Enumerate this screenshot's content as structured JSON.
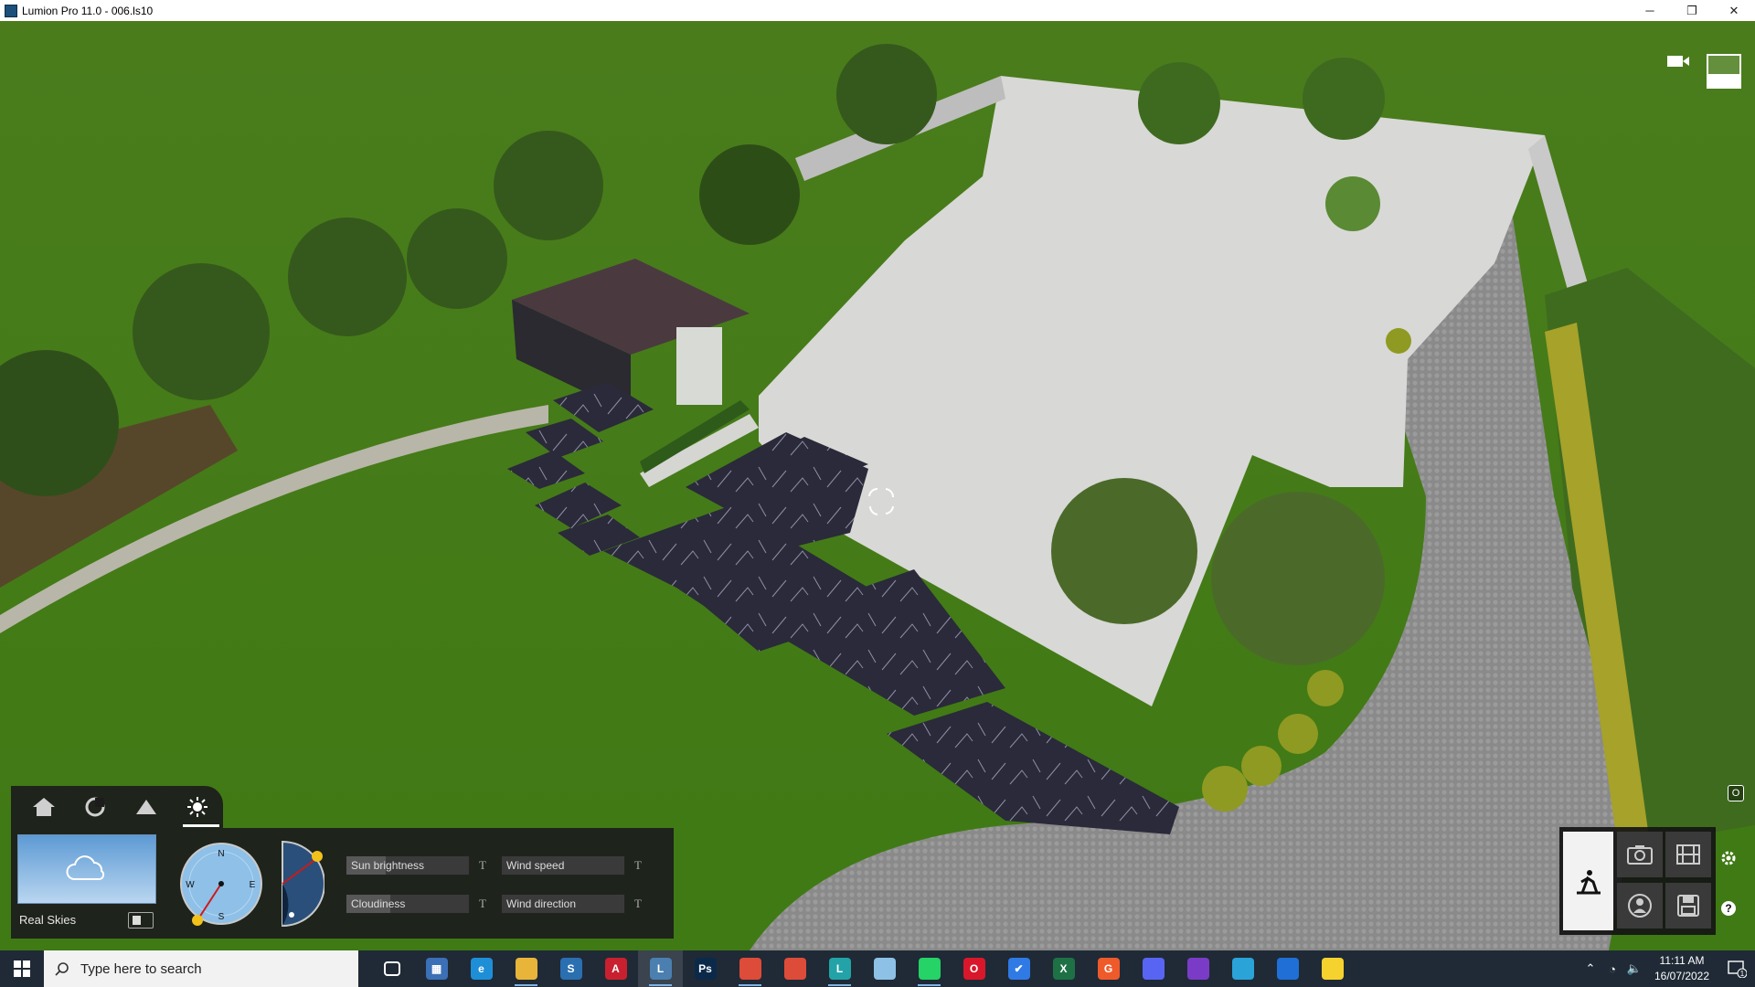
{
  "window": {
    "title": "Lumion Pro 11.0  - 006.ls10",
    "controls": {
      "minimize": "─",
      "restore": "❐",
      "close": "✕"
    }
  },
  "weather_panel": {
    "sky_preset_label": "Real Skies",
    "tabs": [
      "house-icon",
      "material-icon",
      "landscape-icon",
      "sun-icon"
    ],
    "active_tab": "sun-icon",
    "compass": {
      "n": "N",
      "s": "S",
      "e": "E",
      "w": "W"
    },
    "sliders": {
      "sun_brightness": {
        "label": "Sun brightness",
        "level": 0.32,
        "key": "T"
      },
      "cloudiness": {
        "label": "Cloudiness",
        "level": 0.36,
        "key": "T"
      },
      "wind_speed": {
        "label": "Wind speed",
        "level": 0.0,
        "key": "T"
      },
      "wind_direction": {
        "label": "Wind direction",
        "level": 0.0,
        "key": "T"
      }
    }
  },
  "viewport": {
    "key_hint": "O"
  },
  "mode_panel": {
    "modes": [
      "build-mode-icon",
      "photo-mode-icon",
      "movie-mode-icon",
      "360-panorama-icon",
      "save-icon"
    ],
    "side": {
      "settings": "gear-icon",
      "help": "?"
    }
  },
  "taskbar": {
    "search_placeholder": "Type here to search",
    "apps": [
      {
        "name": "task-view",
        "label": "",
        "color": "#1f2a36"
      },
      {
        "name": "calculator",
        "label": "▦",
        "color": "#3b6fb6"
      },
      {
        "name": "edge",
        "label": "e",
        "color": "#1e8fd6"
      },
      {
        "name": "file-explorer",
        "label": "",
        "color": "#e8b53a"
      },
      {
        "name": "sketchup",
        "label": "S",
        "color": "#2a6fb0"
      },
      {
        "name": "autocad",
        "label": "A",
        "color": "#c8202f"
      },
      {
        "name": "lumion",
        "label": "L",
        "color": "#4a7fb0"
      },
      {
        "name": "photoshop",
        "label": "Ps",
        "color": "#0b2a4a"
      },
      {
        "name": "chrome",
        "label": "",
        "color": "#dd4b39"
      },
      {
        "name": "chrome-2",
        "label": "",
        "color": "#dd4b39"
      },
      {
        "name": "lumion-2",
        "label": "L",
        "color": "#23a3a8"
      },
      {
        "name": "notes",
        "label": "",
        "color": "#8ec1e6"
      },
      {
        "name": "whatsapp",
        "label": "",
        "color": "#25d366"
      },
      {
        "name": "opera",
        "label": "O",
        "color": "#d9172b"
      },
      {
        "name": "todo",
        "label": "✔",
        "color": "#2f7ae5"
      },
      {
        "name": "excel",
        "label": "X",
        "color": "#1e7145"
      },
      {
        "name": "grammarly",
        "label": "G",
        "color": "#ef5a2b"
      },
      {
        "name": "discord",
        "label": "",
        "color": "#5865f2"
      },
      {
        "name": "podcast",
        "label": "",
        "color": "#7a3cc7"
      },
      {
        "name": "telegram",
        "label": "",
        "color": "#2aa3d8"
      },
      {
        "name": "3d-app",
        "label": "",
        "color": "#1f6fd6"
      },
      {
        "name": "sticky-notes",
        "label": "",
        "color": "#f6d22e"
      }
    ],
    "clock_time": "11:11 AM",
    "clock_date": "16/07/2022",
    "notification_count": "1"
  }
}
